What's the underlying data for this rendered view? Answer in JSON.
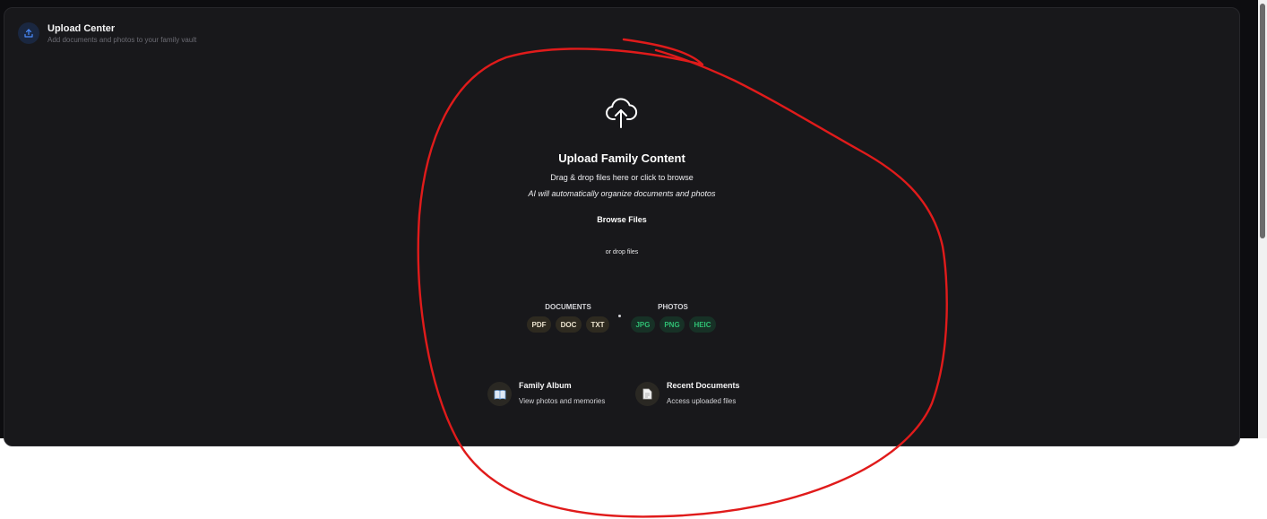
{
  "header": {
    "icon": "upload-icon",
    "title": "Upload Center",
    "subtitle": "Add documents and photos to your family vault"
  },
  "dropzone": {
    "icon": "cloud-upload-icon",
    "title": "Upload Family Content",
    "line1": "Drag & drop files here or click to browse",
    "line2": "AI will automatically organize documents and photos",
    "browse_label": "Browse Files",
    "or_text": "or drop files"
  },
  "file_types": {
    "documents": {
      "label": "DOCUMENTS",
      "types": [
        "PDF",
        "DOC",
        "TXT"
      ]
    },
    "photos": {
      "label": "PHOTOS",
      "types": [
        "JPG",
        "PNG",
        "HEIC"
      ]
    }
  },
  "quick_links": [
    {
      "icon": "book-icon",
      "title": "Family Album",
      "subtitle": "View photos and memories"
    },
    {
      "icon": "document-icon",
      "title": "Recent Documents",
      "subtitle": "Access uploaded files"
    }
  ],
  "colors": {
    "background": "#0d0d10",
    "panel": "#18181b",
    "doc_pill_bg": "#2e2a20",
    "photo_pill_text": "#2fbf73",
    "accent_blue": "#4a8cff",
    "annotation_red": "#e01b1b"
  }
}
